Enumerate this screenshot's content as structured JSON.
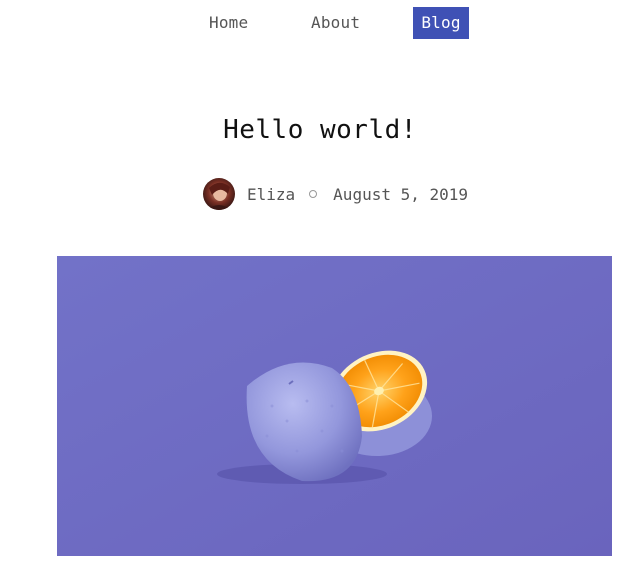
{
  "nav": {
    "items": [
      {
        "label": "Home",
        "active": false
      },
      {
        "label": "About",
        "active": false
      },
      {
        "label": "Blog",
        "active": true
      }
    ],
    "active_color": "#3f51b5"
  },
  "post": {
    "title": "Hello world!",
    "author": "Eliza",
    "date": "August 5, 2019"
  },
  "hero": {
    "background_color": "#6e6ec4",
    "icon": "orange-halves-image"
  }
}
